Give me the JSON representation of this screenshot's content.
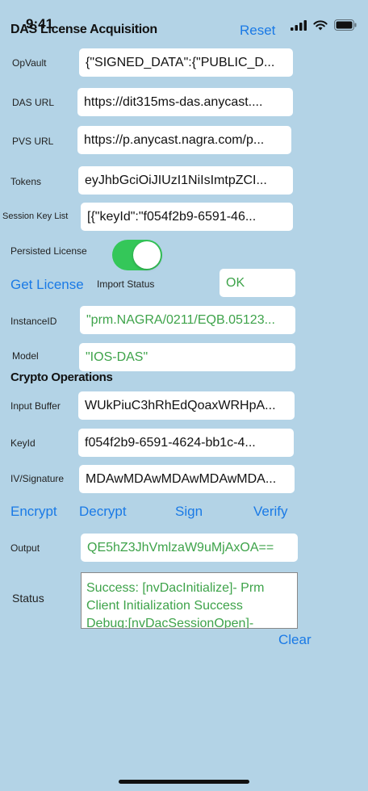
{
  "status_bar": {
    "time": "9:41"
  },
  "header": {
    "title": "DAS License Acquisition",
    "reset_label": "Reset"
  },
  "fields": {
    "opvault": {
      "label": "OpVault",
      "value": "{\"SIGNED_DATA\":{\"PUBLIC_D..."
    },
    "das_url": {
      "label": "DAS URL",
      "value": "https://dit315ms-das.anycast...."
    },
    "pvs_url": {
      "label": "PVS URL",
      "value": "https://p.anycast.nagra.com/p..."
    },
    "tokens": {
      "label": "Tokens",
      "value": "eyJhbGciOiJIUzI1NiIsImtpZCI..."
    },
    "session_key_list": {
      "label": "Session Key List",
      "value": "[{\"keyId\":\"f054f2b9-6591-46..."
    }
  },
  "persisted_license": {
    "label": "Persisted License",
    "on": true
  },
  "get_license_label": "Get License",
  "import_status": {
    "label": "Import Status",
    "value": "OK"
  },
  "instance_id": {
    "label": "InstanceID",
    "value": "\"prm.NAGRA/0211/EQB.05123..."
  },
  "model": {
    "label": "Model",
    "value": "\"IOS-DAS\""
  },
  "crypto": {
    "title": "Crypto Operations",
    "input_buffer": {
      "label": "Input Buffer",
      "value": "WUkPiuC3hRhEdQoaxWRHpA..."
    },
    "keyid": {
      "label": "KeyId",
      "value": "f054f2b9-6591-4624-bb1c-4..."
    },
    "iv_signature": {
      "label": "IV/Signature",
      "value": "MDAwMDAwMDAwMDAwMDA..."
    },
    "actions": {
      "encrypt": "Encrypt",
      "decrypt": "Decrypt",
      "sign": "Sign",
      "verify": "Verify"
    },
    "output": {
      "label": "Output",
      "value": "QE5hZ3JhVmlzaW9uMjAxOA=="
    }
  },
  "status": {
    "label": "Status",
    "lines": [
      "Success: [nvDacInitialize]- Prm",
      "Client Initialization Success",
      "Debug:[nvDacSessionOpen]-"
    ]
  },
  "clear_label": "Clear"
}
